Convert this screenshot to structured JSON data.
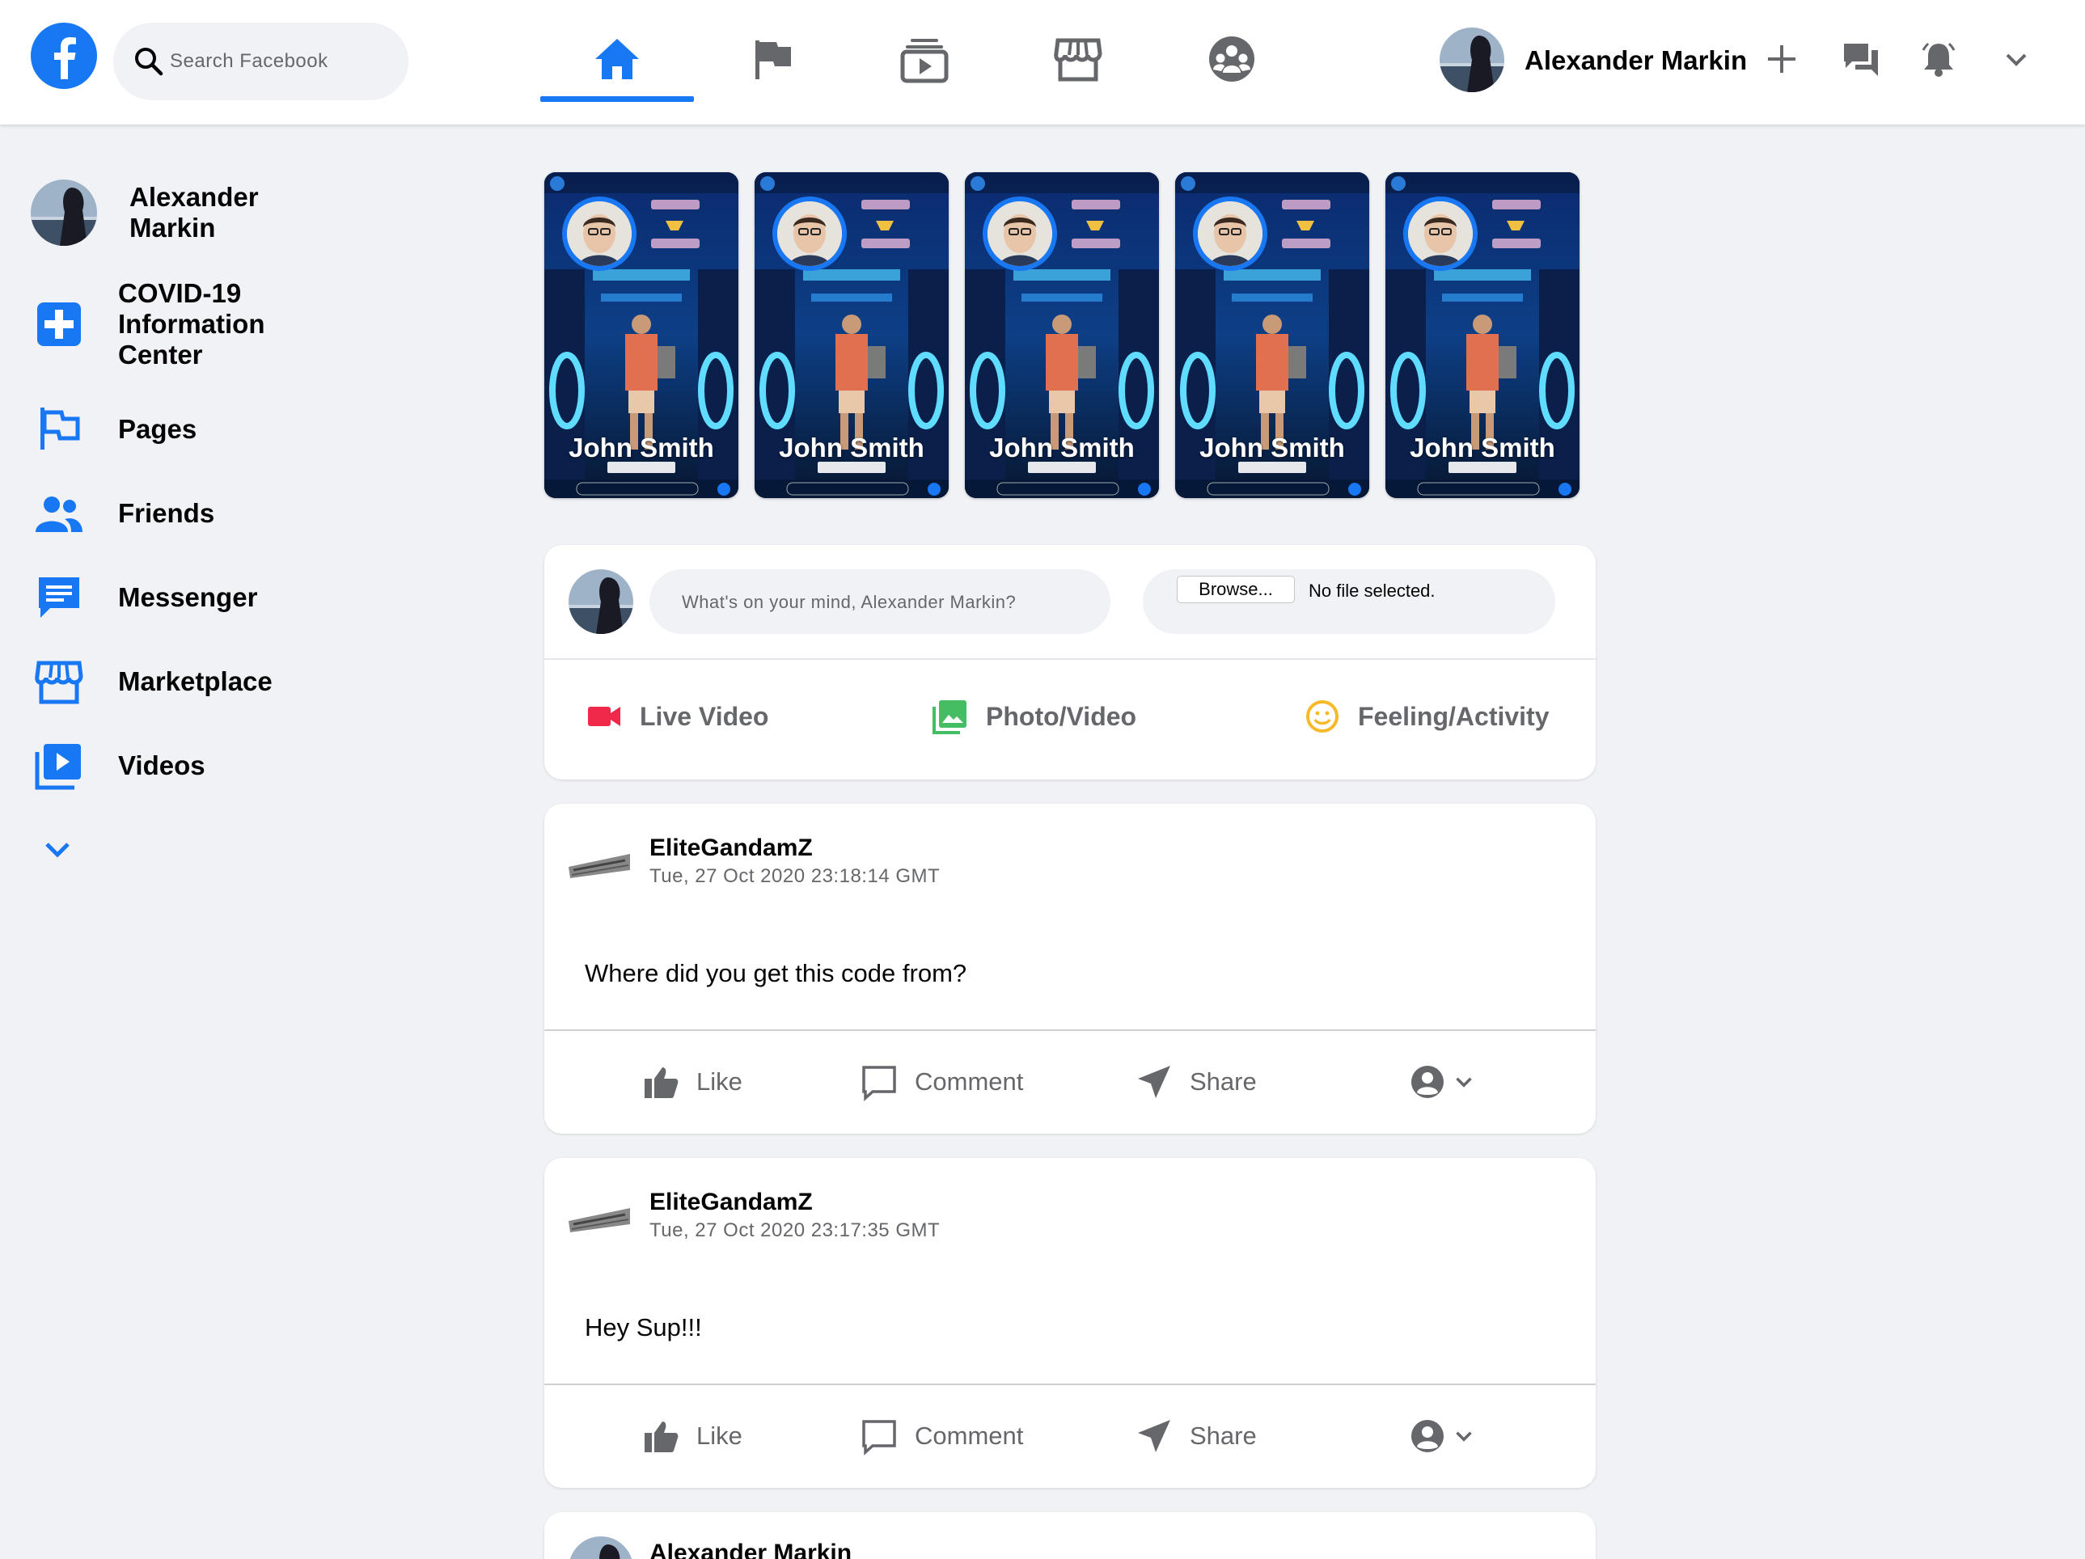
{
  "header": {
    "search_placeholder": "Search Facebook",
    "nav_tabs": [
      {
        "name": "home",
        "icon": "home-icon",
        "active": true
      },
      {
        "name": "pages",
        "icon": "flag-icon",
        "active": false
      },
      {
        "name": "watch",
        "icon": "video-icon",
        "active": false
      },
      {
        "name": "marketplace",
        "icon": "shop-icon",
        "active": false
      },
      {
        "name": "groups",
        "icon": "groups-icon",
        "active": false
      }
    ],
    "user_name": "Alexander Markin",
    "accent_color": "#1877f2"
  },
  "sidebar": {
    "profile_name": "Alexander\nMarkin",
    "items": [
      {
        "label": "COVID-19 Information Center",
        "icon": "medical-cross-icon"
      },
      {
        "label": "Pages",
        "icon": "flag-icon"
      },
      {
        "label": "Friends",
        "icon": "friends-icon"
      },
      {
        "label": "Messenger",
        "icon": "messenger-icon"
      },
      {
        "label": "Marketplace",
        "icon": "shop-icon"
      },
      {
        "label": "Videos",
        "icon": "video-play-icon"
      }
    ],
    "see_more_icon": "chevron-down-icon"
  },
  "stories": [
    {
      "name": "John Smith"
    },
    {
      "name": "John Smith"
    },
    {
      "name": "John Smith"
    },
    {
      "name": "John Smith"
    },
    {
      "name": "John Smith"
    }
  ],
  "composer": {
    "placeholder": "What's on your mind, Alexander Markin?",
    "browse_label": "Browse...",
    "no_file_label": "No file selected.",
    "actions": [
      {
        "label": "Live Video",
        "icon": "video-camera-icon",
        "color": "#f02849"
      },
      {
        "label": "Photo/Video",
        "icon": "photo-icon",
        "color": "#45bd62"
      },
      {
        "label": "Feeling/Activity",
        "icon": "smiley-icon",
        "color": "#f7b928"
      }
    ]
  },
  "posts": [
    {
      "author": "EliteGandamZ",
      "time": "Tue, 27 Oct 2020 23:18:14 GMT",
      "body": "Where did you get this code from?",
      "actions": {
        "like": "Like",
        "comment": "Comment",
        "share": "Share"
      }
    },
    {
      "author": "EliteGandamZ",
      "time": "Tue, 27 Oct 2020 23:17:35 GMT",
      "body": "Hey Sup!!!",
      "actions": {
        "like": "Like",
        "comment": "Comment",
        "share": "Share"
      }
    },
    {
      "author": "Alexander Markin"
    }
  ]
}
